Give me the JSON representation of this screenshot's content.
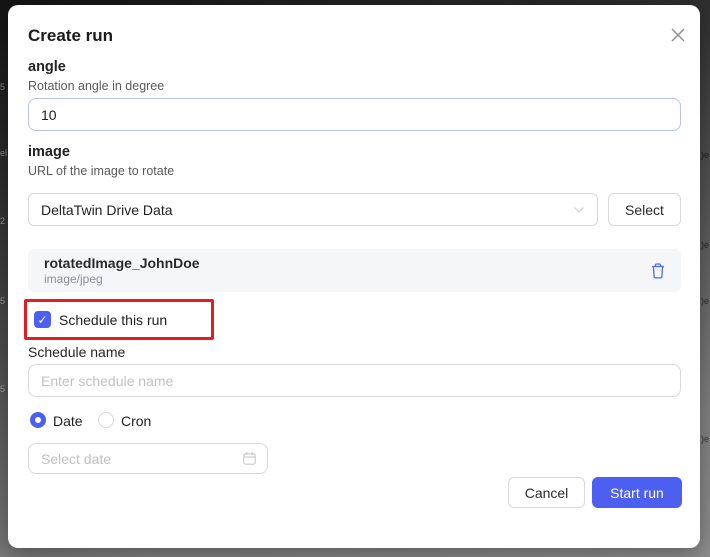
{
  "backdrop": {
    "fragments": [
      {
        "text": "5"
      },
      {
        "text": "el"
      },
      {
        "text": "2"
      },
      {
        "text": "5"
      },
      {
        "text": "5"
      },
      {
        "text": ")e"
      },
      {
        "text": ")e"
      },
      {
        "text": ")e"
      },
      {
        "text": ")e"
      }
    ]
  },
  "modal": {
    "title": "Create run",
    "angle": {
      "label": "angle",
      "hint": "Rotation angle in degree",
      "value": "10"
    },
    "image": {
      "label": "image",
      "hint": "URL of the image to rotate",
      "dropdown_value": "DeltaTwin Drive Data",
      "select_button": "Select"
    },
    "file": {
      "name": "rotatedImage_JohnDoe",
      "mime": "image/jpeg"
    },
    "schedule": {
      "checkbox_label": "Schedule this run",
      "checkbox_checked": true,
      "check_glyph": "✓",
      "name_label": "Schedule name",
      "name_placeholder": "Enter schedule name",
      "type_options": [
        {
          "label": "Date",
          "selected": true
        },
        {
          "label": "Cron",
          "selected": false
        }
      ],
      "date_placeholder": "Select date"
    },
    "footer": {
      "cancel": "Cancel",
      "start": "Start run"
    }
  },
  "colors": {
    "accent": "#4c5ff0",
    "annotation_red": "#e01f1f",
    "angle_input_border": "#b6c2f3",
    "file_row_bg": "#f5f6f8"
  }
}
